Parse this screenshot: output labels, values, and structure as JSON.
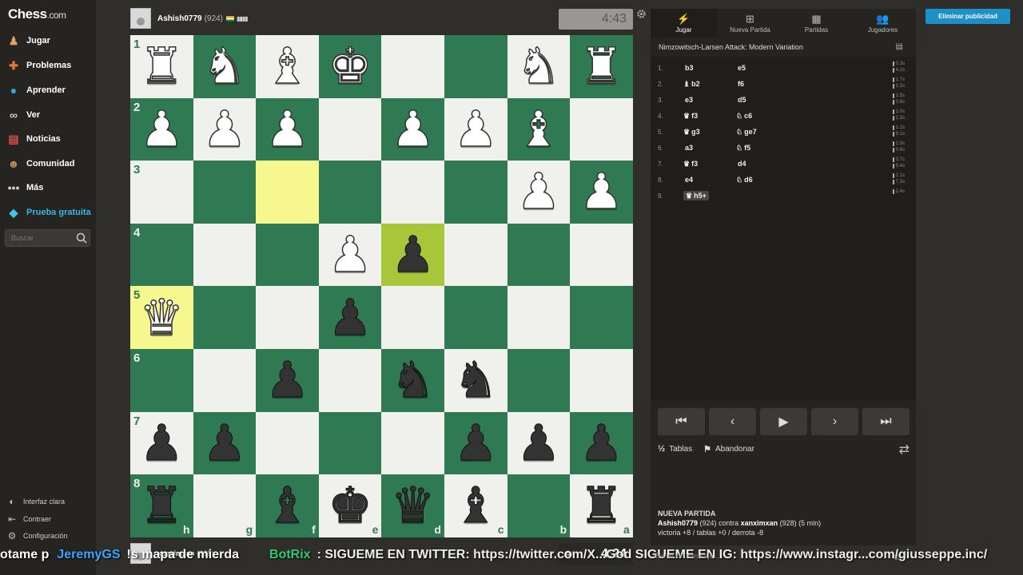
{
  "sidebar": {
    "logo_main": "Chess",
    "logo_domain": ".com",
    "items": [
      {
        "label": "Jugar",
        "icon": "play-icon"
      },
      {
        "label": "Problemas",
        "icon": "puzzle-icon"
      },
      {
        "label": "Aprender",
        "icon": "learn-icon"
      },
      {
        "label": "Ver",
        "icon": "binoculars-icon"
      },
      {
        "label": "Noticias",
        "icon": "news-icon"
      },
      {
        "label": "Comunidad",
        "icon": "community-icon"
      },
      {
        "label": "Más",
        "icon": "more-icon"
      },
      {
        "label": "Prueba gratuita",
        "icon": "diamond-icon"
      }
    ],
    "search_placeholder": "Buscar",
    "footer": [
      {
        "label": "Interfaz clara",
        "icon": "theme-icon"
      },
      {
        "label": "Contraer",
        "icon": "collapse-icon"
      },
      {
        "label": "Configuración",
        "icon": "settings-icon"
      }
    ]
  },
  "top_player": {
    "name": "Ashish0779",
    "rating": "(924)"
  },
  "top_clock": "4:43",
  "bottom_player": {
    "name": "xanximxan",
    "rating": "(928)"
  },
  "bottom_clock": "4:24",
  "ticker": {
    "part1": "otame p",
    "part2": "JeremyGS",
    "part3": "!s mapa de mierda",
    "part4": "BotRix",
    "part5": ": SIGUEME EN TWITTER: https://twitter.com/X...God SIGUEME EN IG: https://www.instagr...com/giusseppe.inc/"
  },
  "board": {
    "ranks": [
      "1",
      "2",
      "3",
      "4",
      "5",
      "6",
      "7",
      "8"
    ],
    "files": [
      "h",
      "g",
      "f",
      "e",
      "d",
      "c",
      "b",
      "a"
    ],
    "rows": [
      [
        "wR",
        "wN",
        "wB",
        "wK",
        "",
        "",
        "wN",
        "wR"
      ],
      [
        "wP",
        "wP",
        "wP",
        "",
        "wP",
        "wP",
        "wB",
        ""
      ],
      [
        "",
        "",
        "",
        "",
        "",
        "",
        "wP",
        "wP"
      ],
      [
        "",
        "",
        "",
        "wP",
        "bP",
        "",
        "",
        ""
      ],
      [
        "wQ",
        "",
        "",
        "bP",
        "",
        "",
        "",
        ""
      ],
      [
        "",
        "",
        "bP",
        "",
        "bN",
        "bN",
        "",
        ""
      ],
      [
        "bP",
        "bP",
        "",
        "",
        "",
        "bP",
        "bP",
        "bP"
      ],
      [
        "bR",
        "",
        "bB",
        "bK",
        "bQ",
        "bB",
        "",
        "bR"
      ]
    ],
    "highlights": [
      {
        "row": 2,
        "col": 2
      },
      {
        "row": 4,
        "col": 0
      }
    ],
    "highlights_dark": [
      {
        "row": 3,
        "col": 4
      }
    ]
  },
  "panel": {
    "tabs": [
      {
        "label": "Jugar",
        "icon": "bolt-icon"
      },
      {
        "label": "Nueva Partida",
        "icon": "plus-icon"
      },
      {
        "label": "Partidas",
        "icon": "board-icon"
      },
      {
        "label": "Jugadores",
        "icon": "players-icon"
      }
    ],
    "opening": "Nimzowitsch-Larsen Attack: Modern Variation",
    "moves": [
      {
        "n": "1.",
        "w": "b3",
        "wp": "",
        "b": "e5",
        "bp": "",
        "t": [
          "0.3s",
          "4.2s"
        ]
      },
      {
        "n": "2.",
        "w": "b2",
        "wp": "♝",
        "b": "f6",
        "bp": "",
        "t": [
          "1.7s",
          "0.3s"
        ]
      },
      {
        "n": "3.",
        "w": "e3",
        "wp": "",
        "b": "d5",
        "bp": "",
        "t": [
          "1.5s",
          "0.6s"
        ]
      },
      {
        "n": "4.",
        "w": "f3",
        "wp": "♛",
        "b": "c6",
        "bp": "♘",
        "t": [
          "1.0s",
          "2.3s"
        ]
      },
      {
        "n": "5.",
        "w": "g3",
        "wp": "♛",
        "b": "ge7",
        "bp": "♘",
        "t": [
          "1.2s",
          "9.1s"
        ]
      },
      {
        "n": "6.",
        "w": "a3",
        "wp": "",
        "b": "f5",
        "bp": "♘",
        "t": [
          "2.3s",
          "0.8s"
        ]
      },
      {
        "n": "7.",
        "w": "f3",
        "wp": "♛",
        "b": "d4",
        "bp": "",
        "t": [
          "3.7s",
          "9.4s"
        ]
      },
      {
        "n": "8.",
        "w": "e4",
        "wp": "",
        "b": "d6",
        "bp": "♘",
        "t": [
          "2.1s",
          "7.3s"
        ]
      },
      {
        "n": "9.",
        "w": "h5+",
        "wp": "♛",
        "b": "",
        "bp": "",
        "t": [
          "2.4s"
        ]
      }
    ],
    "draw_label": "Tablas",
    "resign_label": "Abandonar",
    "new_game": {
      "heading": "NUEVA PARTIDA",
      "white": "Ashish0779",
      "white_rating": "(924)",
      "vs": "contra",
      "black": "xanximxan",
      "black_rating": "(928) (5 min)",
      "result": "victoria +8 / tablas +0 / derrota -8"
    },
    "chat_placeholder": "Enviar un mensaje..."
  },
  "remove_ads": "Eliminar publicidad",
  "colors": {
    "light_square": "#f0f0ec",
    "dark_square": "#2f7a52",
    "highlight": "#f7f78f",
    "accent": "#1e90c8"
  }
}
